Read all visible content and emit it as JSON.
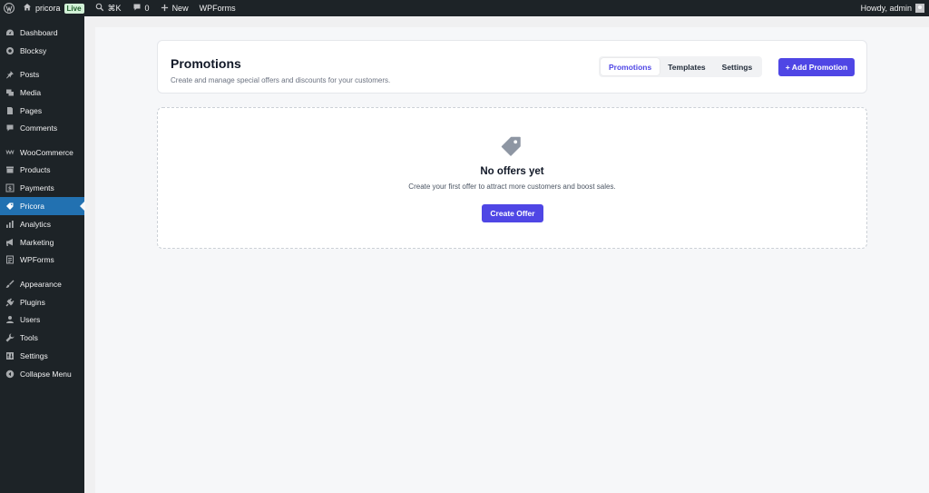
{
  "adminbar": {
    "site_name": "pricora",
    "live_badge": "Live",
    "shortcut": "⌘K",
    "comments_count": "0",
    "new_label": "New",
    "wpforms_label": "WPForms",
    "greeting": "Howdy, admin"
  },
  "sidebar": {
    "items": [
      {
        "label": "Dashboard",
        "icon": "dashboard-icon"
      },
      {
        "label": "Blocksy",
        "icon": "blocksy-icon"
      },
      {
        "label": "Posts",
        "icon": "pin-icon"
      },
      {
        "label": "Media",
        "icon": "media-icon"
      },
      {
        "label": "Pages",
        "icon": "page-icon"
      },
      {
        "label": "Comments",
        "icon": "comment-icon"
      },
      {
        "label": "WooCommerce",
        "icon": "woocommerce-icon"
      },
      {
        "label": "Products",
        "icon": "archive-icon"
      },
      {
        "label": "Payments",
        "icon": "dollar-icon"
      },
      {
        "label": "Pricora",
        "icon": "pricora-icon"
      },
      {
        "label": "Analytics",
        "icon": "bar-chart-icon"
      },
      {
        "label": "Marketing",
        "icon": "megaphone-icon"
      },
      {
        "label": "WPForms",
        "icon": "forms-icon"
      },
      {
        "label": "Appearance",
        "icon": "brush-icon"
      },
      {
        "label": "Plugins",
        "icon": "plug-icon"
      },
      {
        "label": "Users",
        "icon": "users-icon"
      },
      {
        "label": "Tools",
        "icon": "wrench-icon"
      },
      {
        "label": "Settings",
        "icon": "settings-icon"
      },
      {
        "label": "Collapse Menu",
        "icon": "collapse-icon"
      }
    ],
    "active": "Pricora"
  },
  "header": {
    "title": "Promotions",
    "subtitle": "Create and manage special offers and discounts for your customers.",
    "tabs": [
      "Promotions",
      "Templates",
      "Settings"
    ],
    "active_tab": "Promotions",
    "add_button": "+ Add Promotion"
  },
  "empty_state": {
    "icon": "tag-icon",
    "title": "No offers yet",
    "text": "Create your first offer to attract more customers and boost sales.",
    "button": "Create Offer"
  },
  "colors": {
    "accent": "#4f46e5",
    "sidebar_bg": "#1d2327",
    "active_menu": "#2271b1"
  }
}
